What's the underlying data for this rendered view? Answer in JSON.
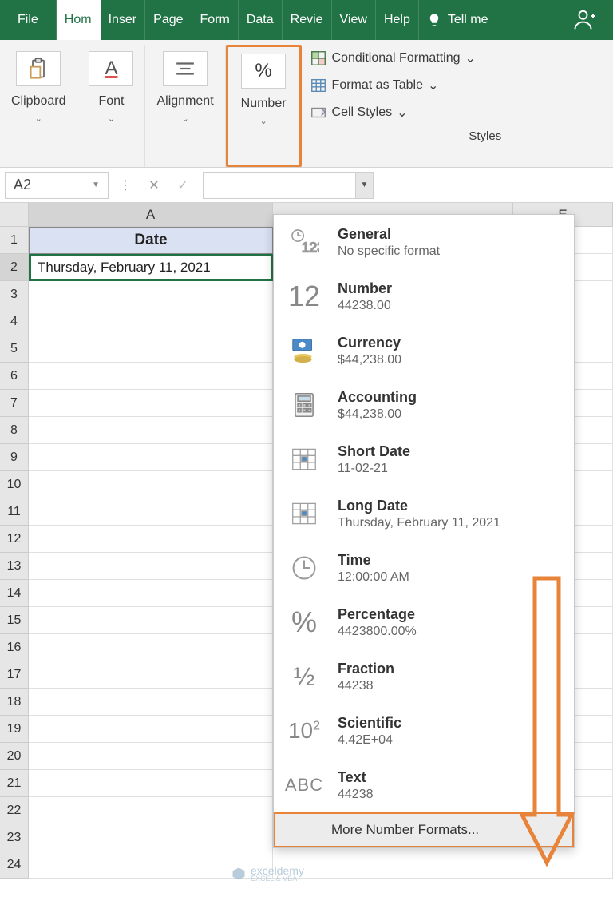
{
  "tabs": {
    "file": "File",
    "home": "Hom",
    "insert": "Inser",
    "page": "Page",
    "form": "Form",
    "data": "Data",
    "review": "Revie",
    "view": "View",
    "help": "Help",
    "tell": "Tell me"
  },
  "ribbon": {
    "clipboard": "Clipboard",
    "font": "Font",
    "alignment": "Alignment",
    "number": "Number",
    "percent_icon": "%",
    "font_icon": "A",
    "cond_format": "Conditional Formatting",
    "fmt_table": "Format as Table",
    "cell_styles": "Cell Styles",
    "styles_label": "Styles"
  },
  "namebox": "A2",
  "columns": {
    "A": "A",
    "E": "E"
  },
  "rows": [
    "1",
    "2",
    "3",
    "4",
    "5",
    "6",
    "7",
    "8",
    "9",
    "10",
    "11",
    "12",
    "13",
    "14",
    "15",
    "16",
    "17",
    "18",
    "19",
    "20",
    "21",
    "22",
    "23",
    "24"
  ],
  "header_cell": "Date",
  "a2_value": "Thursday, February 11, 2021",
  "formats": [
    {
      "title": "General",
      "sub": "No specific format"
    },
    {
      "title": "Number",
      "sub": "44238.00"
    },
    {
      "title": "Currency",
      "sub": "$44,238.00"
    },
    {
      "title": "Accounting",
      "sub": " $44,238.00"
    },
    {
      "title": "Short Date",
      "sub": "11-02-21"
    },
    {
      "title": "Long Date",
      "sub": "Thursday, February 11, 2021"
    },
    {
      "title": "Time",
      "sub": "12:00:00 AM"
    },
    {
      "title": "Percentage",
      "sub": "4423800.00%"
    },
    {
      "title": "Fraction",
      "sub": "44238"
    },
    {
      "title": "Scientific",
      "sub": "4.42E+04"
    },
    {
      "title": "Text",
      "sub": "44238"
    }
  ],
  "more_formats": "More Number Formats...",
  "watermark": {
    "name": "exceldemy",
    "sub": "EXCEL & VBA"
  }
}
